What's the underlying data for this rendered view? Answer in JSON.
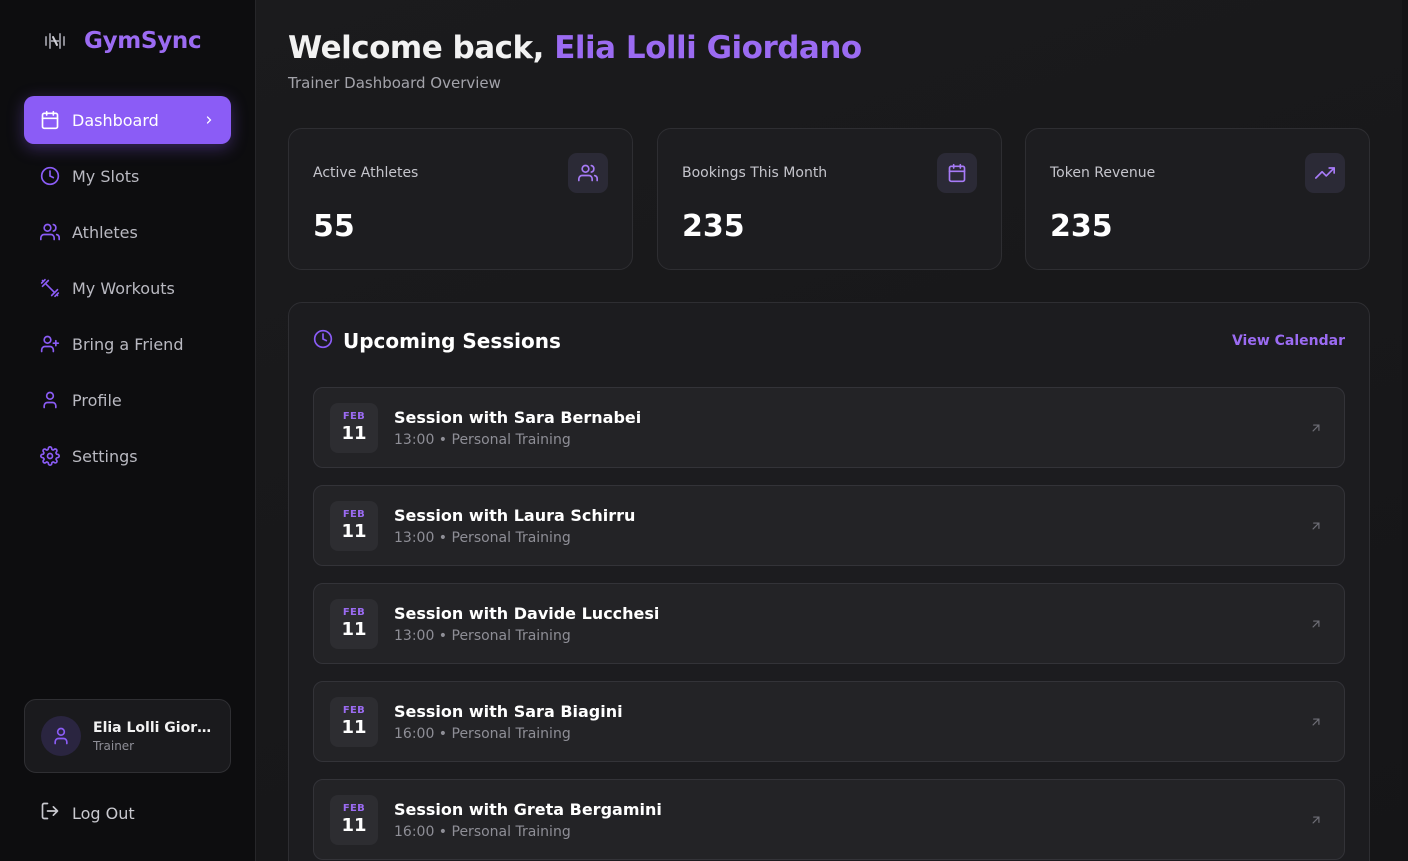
{
  "brand": {
    "name": "GymSync",
    "logo_icon": "dumbbell-logo-icon"
  },
  "sidebar": {
    "items": [
      {
        "label": "Dashboard",
        "icon": "calendar-icon",
        "active": true
      },
      {
        "label": "My Slots",
        "icon": "clock-icon"
      },
      {
        "label": "Athletes",
        "icon": "users-icon"
      },
      {
        "label": "My Workouts",
        "icon": "dumbbell-icon"
      },
      {
        "label": "Bring a Friend",
        "icon": "user-plus-icon"
      },
      {
        "label": "Profile",
        "icon": "user-icon"
      },
      {
        "label": "Settings",
        "icon": "gear-icon"
      }
    ],
    "user": {
      "name": "Elia Lolli Giordano",
      "role": "Trainer"
    },
    "logout_label": "Log Out"
  },
  "header": {
    "welcome_prefix": "Welcome back,",
    "user_name": "Elia Lolli Giordano",
    "subtitle": "Trainer Dashboard Overview"
  },
  "stats": [
    {
      "label": "Active Athletes",
      "value": "55",
      "icon": "users-icon"
    },
    {
      "label": "Bookings This Month",
      "value": "235",
      "icon": "calendar-icon"
    },
    {
      "label": "Token Revenue",
      "value": "235",
      "icon": "trending-up-icon"
    }
  ],
  "sessions": {
    "title": "Upcoming Sessions",
    "view_calendar": "View Calendar",
    "items": [
      {
        "month": "FEB",
        "day": "11",
        "title": "Session with Sara Bernabei",
        "meta": "13:00 • Personal Training"
      },
      {
        "month": "FEB",
        "day": "11",
        "title": "Session with Laura Schirru",
        "meta": "13:00 • Personal Training"
      },
      {
        "month": "FEB",
        "day": "11",
        "title": "Session with Davide Lucchesi",
        "meta": "13:00 • Personal Training"
      },
      {
        "month": "FEB",
        "day": "11",
        "title": "Session with Sara Biagini",
        "meta": "16:00 • Personal Training"
      },
      {
        "month": "FEB",
        "day": "11",
        "title": "Session with Greta Bergamini",
        "meta": "16:00 • Personal Training"
      }
    ]
  },
  "colors": {
    "accent": "#8b5cf6",
    "accent_text": "#9b6bf2",
    "background": "#171717",
    "sidebar": "#0d0d0f"
  }
}
